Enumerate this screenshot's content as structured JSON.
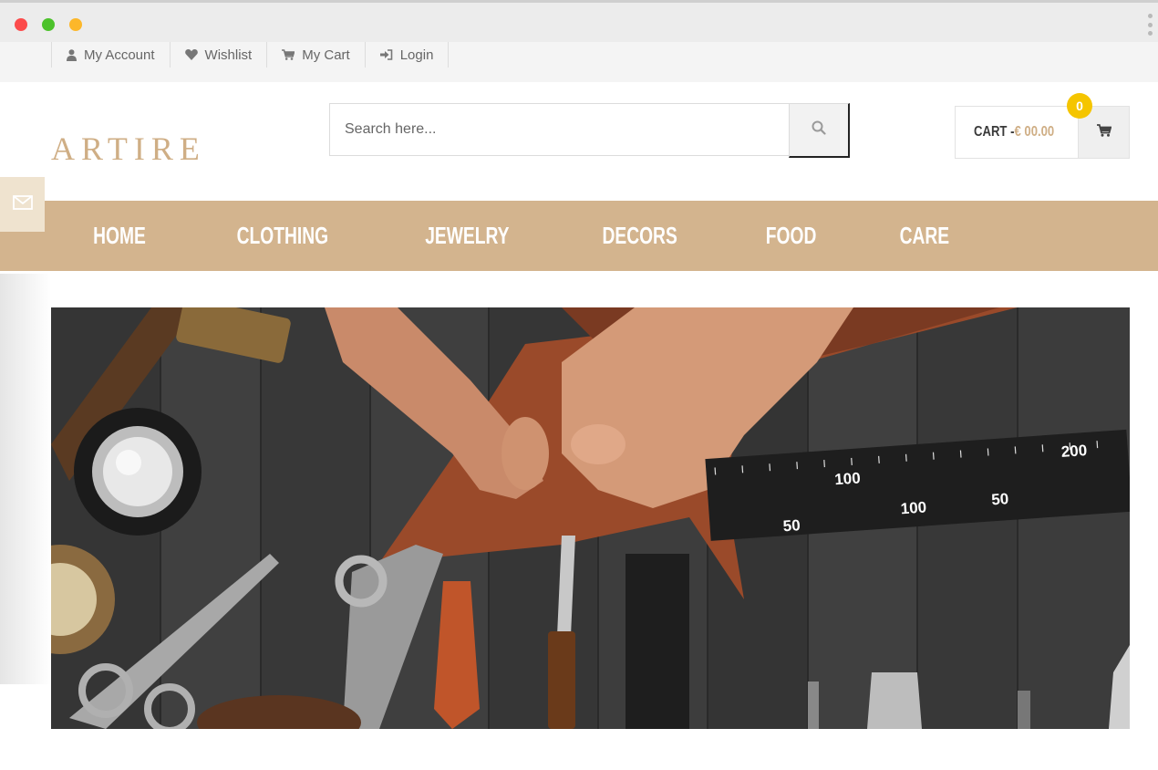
{
  "window": {
    "buttons": [
      "close",
      "minimize",
      "maximize"
    ],
    "menu_icon": "kebab-menu-icon"
  },
  "topbar": {
    "links": [
      {
        "label": "My Account",
        "icon": "user-icon"
      },
      {
        "label": "Wishlist",
        "icon": "heart-icon"
      },
      {
        "label": "My Cart",
        "icon": "cart-icon"
      },
      {
        "label": "Login",
        "icon": "login-icon"
      }
    ]
  },
  "header": {
    "logo": "ARTIRE",
    "search": {
      "placeholder": "Search here...",
      "icon": "search-icon"
    },
    "cart": {
      "label": "CART - ",
      "amount": "€ 00.00",
      "count": "0",
      "icon": "cart-icon"
    }
  },
  "sidebar_tab": {
    "icon": "envelope-icon"
  },
  "nav": {
    "items": [
      {
        "label": "HOME"
      },
      {
        "label": "CLOTHING"
      },
      {
        "label": "JEWELRY"
      },
      {
        "label": "DECORS"
      },
      {
        "label": "FOOD"
      },
      {
        "label": "CARE"
      }
    ]
  },
  "hero": {
    "ruler_numbers": [
      "100",
      "200",
      "50",
      "100",
      "50"
    ]
  },
  "colors": {
    "accent": "#d3b48e",
    "logo": "#cfae85",
    "badge": "#f5c500",
    "topbar_bg": "#f4f4f4"
  }
}
